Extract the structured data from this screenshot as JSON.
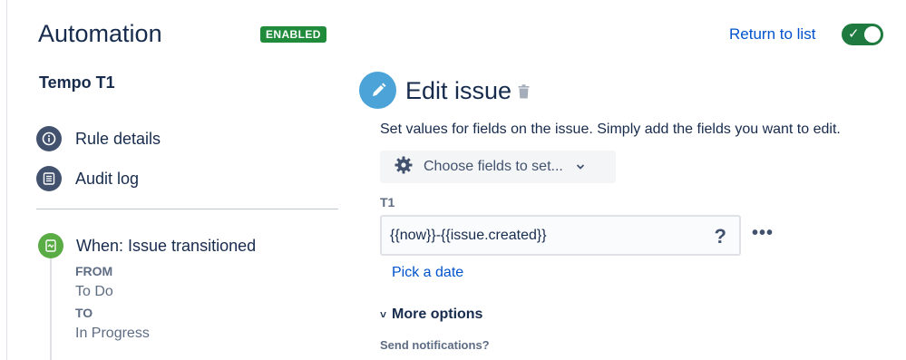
{
  "header": {
    "title": "Automation",
    "status_badge": "ENABLED",
    "return_link": "Return to list",
    "toggle_on": true
  },
  "sidebar": {
    "rule_name": "Tempo T1",
    "items": [
      {
        "label": "Rule details",
        "icon": "info-icon"
      },
      {
        "label": "Audit log",
        "icon": "list-icon"
      }
    ],
    "trigger": {
      "label": "When: Issue transitioned",
      "from_label": "FROM",
      "from_value": "To Do",
      "to_label": "TO",
      "to_value": "In Progress"
    }
  },
  "action": {
    "title": "Edit issue",
    "description": "Set values for fields on the issue. Simply add the fields you want to edit.",
    "choose_fields_label": "Choose fields to set...",
    "field": {
      "label": "T1",
      "value": "{{now}}-{{issue.created}}",
      "help": "?"
    },
    "more_menu": "•••",
    "pick_date": "Pick a date",
    "more_options": "More options",
    "send_notifications": "Send notifications?"
  },
  "colors": {
    "accent_link": "#0052CC",
    "enabled_green": "#1f8b3b",
    "trigger_green": "#5aac44",
    "action_blue": "#4ba3d8",
    "nav_icon": "#42526E"
  }
}
